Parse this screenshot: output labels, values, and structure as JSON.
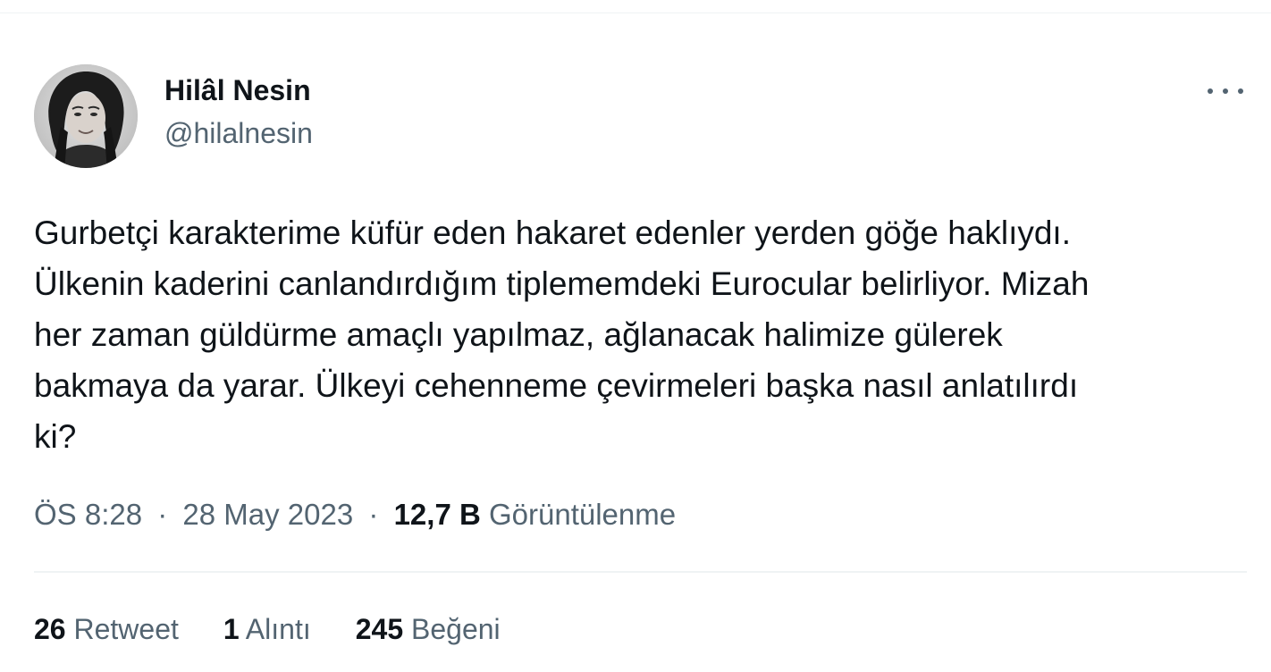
{
  "author": {
    "display_name": "Hilâl Nesin",
    "handle": "@hilalnesin"
  },
  "tweet": {
    "text": "Gurbetçi karakterime küfür eden hakaret edenler yerden göğe haklıydı.\nÜlkenin kaderini canlandırdığım tiplememdeki Eurocular belirliyor. Mizah\nher zaman güldürme amaçlı yapılmaz, ağlanacak halimize gülerek\nbakmaya da yarar. Ülkeyi cehenneme çevirmeleri başka nasıl anlatılırdı\nki?",
    "time": "ÖS 8:28",
    "date": "28 May 2023",
    "separator": "·",
    "views_count": "12,7 B",
    "views_label": "Görüntülenme"
  },
  "stats": {
    "retweets_count": "26",
    "retweets_label": "Retweet",
    "quotes_count": "1",
    "quotes_label": "Alıntı",
    "likes_count": "245",
    "likes_label": "Beğeni"
  },
  "icons": {
    "more": "more-horizontal-icon",
    "avatar": "profile-photo"
  },
  "colors": {
    "text_primary": "#0f1419",
    "text_secondary": "#536471",
    "divider": "#eff3f4"
  }
}
